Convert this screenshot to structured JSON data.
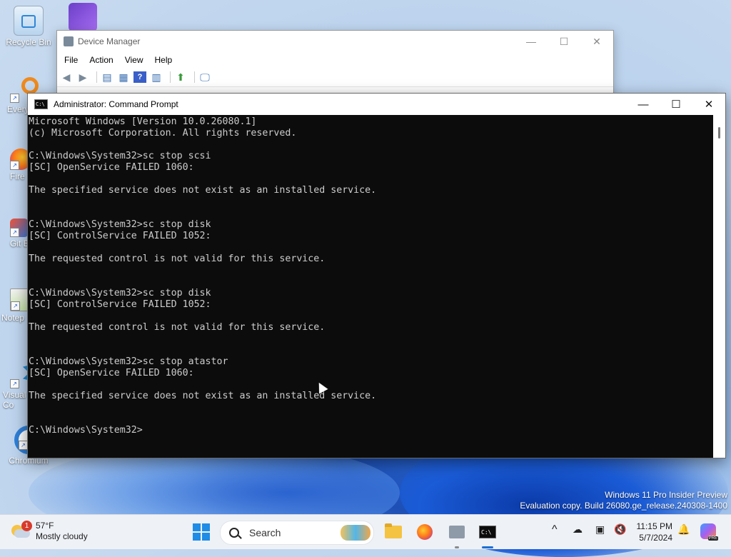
{
  "desktop": {
    "icons": [
      {
        "label": "Recycle Bin"
      },
      {
        "label": ""
      },
      {
        "label": "Every"
      },
      {
        "label": "Fire"
      },
      {
        "label": "Git B"
      },
      {
        "label": "Notep"
      },
      {
        "label": "Visual\nCo"
      },
      {
        "label": "Chromium"
      }
    ]
  },
  "device_manager": {
    "title": "Device Manager",
    "menu": [
      "File",
      "Action",
      "View",
      "Help"
    ],
    "controls": {
      "minimize": "—",
      "maximize": "☐",
      "close": "✕"
    }
  },
  "command_prompt": {
    "title": "Administrator: Command Prompt",
    "icon_text": "C:\\",
    "controls": {
      "minimize": "—",
      "maximize": "☐",
      "close": "✕"
    },
    "lines": [
      "Microsoft Windows [Version 10.0.26080.1]",
      "(c) Microsoft Corporation. All rights reserved.",
      "",
      "C:\\Windows\\System32>sc stop scsi",
      "[SC] OpenService FAILED 1060:",
      "",
      "The specified service does not exist as an installed service.",
      "",
      "",
      "C:\\Windows\\System32>sc stop disk",
      "[SC] ControlService FAILED 1052:",
      "",
      "The requested control is not valid for this service.",
      "",
      "",
      "C:\\Windows\\System32>sc stop disk",
      "[SC] ControlService FAILED 1052:",
      "",
      "The requested control is not valid for this service.",
      "",
      "",
      "C:\\Windows\\System32>sc stop atastor",
      "[SC] OpenService FAILED 1060:",
      "",
      "The specified service does not exist as an installed service.",
      "",
      "",
      "C:\\Windows\\System32>"
    ]
  },
  "watermark": {
    "line1": "Windows 11 Pro Insider Preview",
    "line2": "Evaluation copy. Build 26080.ge_release.240308-1400"
  },
  "taskbar": {
    "weather": {
      "badge": "1",
      "temp": "57°F",
      "condition": "Mostly cloudy"
    },
    "search_placeholder": "Search",
    "tray": {
      "chevron": "^"
    },
    "clock": {
      "time": "11:15 PM",
      "date": "5/7/2024"
    },
    "copilot_badge": "PRE"
  }
}
